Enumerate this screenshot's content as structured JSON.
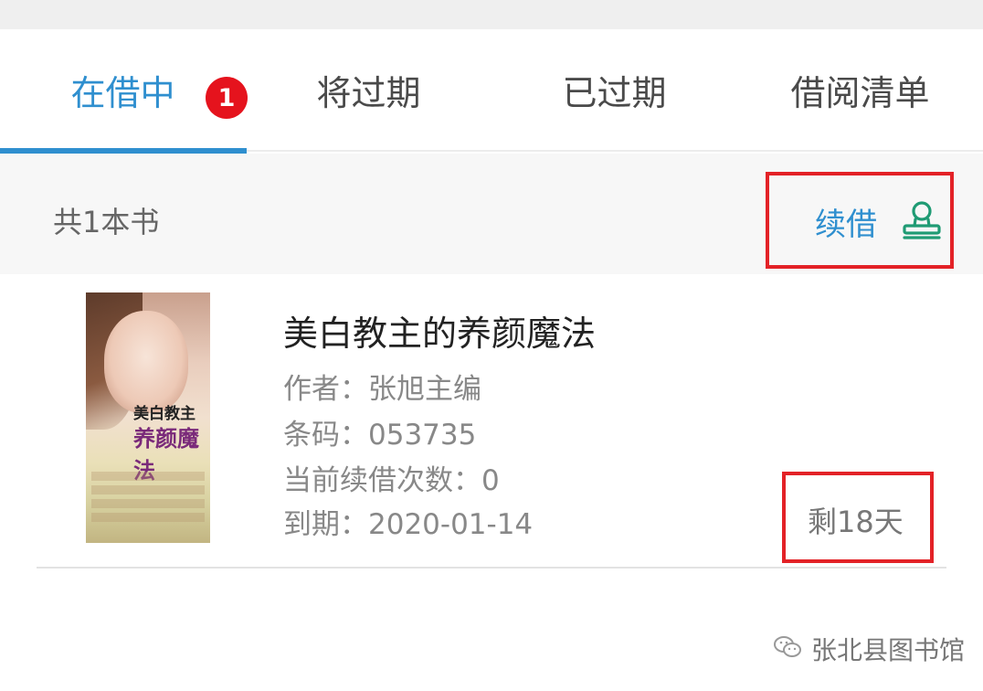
{
  "tabs": [
    {
      "label": "在借中",
      "active": true,
      "badge": "1"
    },
    {
      "label": "将过期",
      "active": false
    },
    {
      "label": "已过期",
      "active": false
    },
    {
      "label": "借阅清单",
      "active": false
    }
  ],
  "summary": {
    "count_text": "共1本书"
  },
  "renew": {
    "label": "续借",
    "icon": "stamp-icon"
  },
  "book": {
    "title": "美白教主的养颜魔法",
    "author": "作者：张旭主编",
    "barcode": "条码：053735",
    "renew_count": "当前续借次数：0",
    "due": "到期：2020-01-14",
    "remaining": "剩18天",
    "cover_text_1": "美白教主",
    "cover_text_2": "养颜魔法"
  },
  "watermark": {
    "label": "张北县图书馆",
    "icon": "wechat-icon"
  },
  "colors": {
    "accent": "#2f8fcf",
    "badge": "#e5131d",
    "highlight": "#e32227",
    "icon_green": "#1f9b74"
  }
}
